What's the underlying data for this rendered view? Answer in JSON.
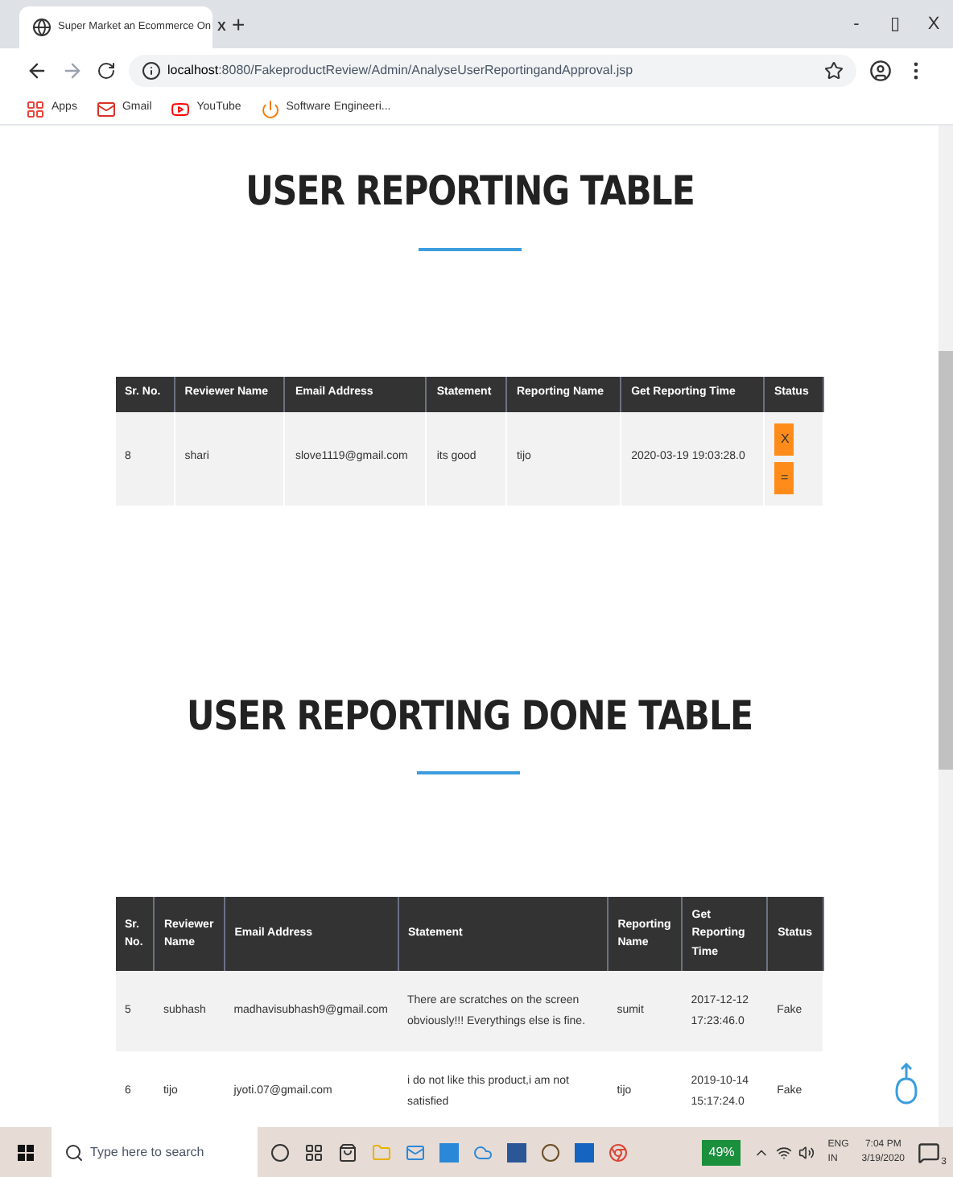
{
  "browser": {
    "tab_title": "Super Market an Ecommerce On",
    "tab_close": "X",
    "new_tab": "+",
    "window_controls": [
      "-",
      "▯",
      "X"
    ],
    "url_host": "localhost",
    "url_rest": ":8080/FakeproductReview/Admin/AnalyseUserReportingandApproval.jsp",
    "bookmarks": [
      {
        "label": "Apps",
        "kind": "apps"
      },
      {
        "label": "Gmail",
        "kind": "gmail"
      },
      {
        "label": "YouTube",
        "kind": "youtube"
      },
      {
        "label": "Software Engineeri...",
        "kind": "power"
      }
    ]
  },
  "reporting": {
    "title": "USER REPORTING TABLE",
    "columns": [
      "Sr. No.",
      "Reviewer Name",
      "Email Address",
      "Statement",
      "Reporting Name",
      "Get Reporting Time",
      "Status"
    ],
    "rows": [
      {
        "cells": [
          "8",
          "shari",
          "slove1119@gmail.com",
          "its good",
          "tijo",
          "2020-03-19 19:03:28.0"
        ],
        "actions": [
          "X",
          "="
        ]
      }
    ]
  },
  "done": {
    "title": "USER REPORTING DONE TABLE",
    "columns": [
      "Sr. No.",
      "Reviewer Name",
      "Email Address",
      "Statement",
      "Reporting Name",
      "Get Reporting Time",
      "Status"
    ],
    "rows": [
      {
        "cells": [
          "5",
          "subhash",
          "madhavisubhash9@gmail.com",
          "There are scratches on the screen obviously!!! Everythings else is fine.",
          "sumit",
          "2017-12-12 17:23:46.0",
          "Fake"
        ]
      },
      {
        "cells": [
          "6",
          "tijo",
          "jyoti.07@gmail.com",
          "i do not like this product,i am not satisfied",
          "tijo",
          "2019-10-14 15:17:24.0",
          "Fake"
        ]
      }
    ]
  },
  "taskbar": {
    "search_placeholder": "Type here to search",
    "battery": "49%",
    "lang_top": "ENG",
    "lang_bottom": "IN",
    "time": "7:04 PM",
    "date": "3/19/2020",
    "notifications": "3"
  }
}
